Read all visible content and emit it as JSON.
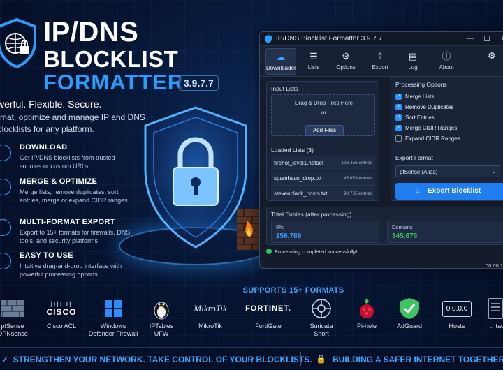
{
  "brand": {
    "title_line1": "IP/DNS",
    "title_line2": "BLOCKLIST",
    "title_line3": "FORMATTER",
    "version": "3.9.7.7",
    "tagline": "werful. Flexible. Secure.",
    "description": "rmat, optimize and manage IP and DNS blocklists for any platform."
  },
  "features": [
    {
      "icon": "download-icon",
      "title": "DOWNLOAD",
      "desc": "Get IP/DNS blocklists from trusted sources or custom URLs"
    },
    {
      "icon": "merge-icon",
      "title": "MERGE & OPTIMIZE",
      "desc": "Merge lists, remove duplicates, sort entries, merge or expand CIDR ranges"
    },
    {
      "icon": "export-icon",
      "title": "MULTI-FORMAT EXPORT",
      "desc": "Export to 15+ formats for firewalls, DNS tools, and security platforms"
    },
    {
      "icon": "shield-check-icon",
      "title": "EASY TO USE",
      "desc": "Intuitive drag-and-drop interface with powerful processing options"
    }
  ],
  "window": {
    "title": "IP/DNS Blocklist Formatter 3.9.7.7",
    "controls": {
      "minimize": "—",
      "maximize": "☐",
      "close": "✕"
    },
    "toolbar": [
      {
        "label": "Downloader",
        "icon": "cloud-download-icon",
        "glyph": "☁",
        "active": true
      },
      {
        "label": "Lists",
        "icon": "list-icon",
        "glyph": "☰",
        "active": false
      },
      {
        "label": "Options",
        "icon": "gear-icon",
        "glyph": "⚙",
        "active": false
      },
      {
        "label": "Export",
        "icon": "upload-icon",
        "glyph": "⇪",
        "active": false
      },
      {
        "label": "Log",
        "icon": "document-icon",
        "glyph": "▤",
        "active": false
      },
      {
        "label": "About",
        "icon": "info-icon",
        "glyph": "ⓘ",
        "active": false
      }
    ],
    "settings_glyph": "⚙",
    "input_lists": {
      "title": "Input Lists",
      "drop_text": "Drag & Drop Files Here",
      "or_text": "or",
      "add_files": "Add Files"
    },
    "loaded_lists": {
      "title": "Loaded Lists (3)",
      "files": [
        {
          "name": "firehol_level1.netset",
          "count": "123,456 entries"
        },
        {
          "name": "spamhaus_drop.txt",
          "count": "45,678 entries"
        },
        {
          "name": "stevenblack_hosts.txt",
          "count": "98,765 entries"
        }
      ]
    },
    "processing": {
      "title": "Processing Options",
      "options": [
        {
          "label": "Merge Lists",
          "checked": true
        },
        {
          "label": "Remove Duplicates",
          "checked": true
        },
        {
          "label": "Sort Entries",
          "checked": true
        },
        {
          "label": "Merge CIDR Ranges",
          "checked": true
        },
        {
          "label": "Expand CIDR Ranges",
          "checked": false
        }
      ]
    },
    "export_format": {
      "title": "Export Format",
      "selected": "pfSense (Alias)",
      "button": "Export Blocklist"
    },
    "totals": {
      "title": "Total Entries (after processing)",
      "ips_label": "IPs",
      "ips_value": "256,789",
      "domains_label": "Domains",
      "domains_value": "345,678"
    },
    "status": "Processing completed successfully!",
    "timer": "00:00:1"
  },
  "formats_heading": "SUPPORTS 15+ FORMATS",
  "formats": [
    {
      "name": "pfSense\nOPNsense",
      "icon": "firewall-brick-icon"
    },
    {
      "name": "Cisco ACL",
      "icon": "cisco-logo-icon",
      "logo_text": "CISCO"
    },
    {
      "name": "Windows\nDefender Firewall",
      "icon": "windows-logo-icon"
    },
    {
      "name": "IPTables\nUFW",
      "icon": "linux-penguin-icon"
    },
    {
      "name": "MikroTik",
      "icon": "mikrotik-logo-icon",
      "logo_text": "MikroTik"
    },
    {
      "name": "FortiGate",
      "icon": "fortinet-logo-icon",
      "logo_text": "FORTINET."
    },
    {
      "name": "Suricata\nSnort",
      "icon": "suricata-icon"
    },
    {
      "name": "Pi-hole",
      "icon": "raspberry-icon"
    },
    {
      "name": "AdGuard",
      "icon": "adguard-shield-icon"
    },
    {
      "name": "Hosts",
      "icon": "hosts-box-icon",
      "logo_text": "0.0.0.0"
    },
    {
      "name": ".htac",
      "icon": "htaccess-icon"
    }
  ],
  "footer": {
    "left": "STRENGTHEN YOUR NETWORK. TAKE CONTROL OF YOUR BLOCKLISTS.",
    "right": "BUILDING A SAFER INTERNET TOGETHER."
  },
  "colors": {
    "accent": "#2a9dff",
    "button": "#1f7df0",
    "ips_value": "#3fa0ff",
    "domains_value": "#3ec463",
    "status_ok": "#2fc463"
  }
}
